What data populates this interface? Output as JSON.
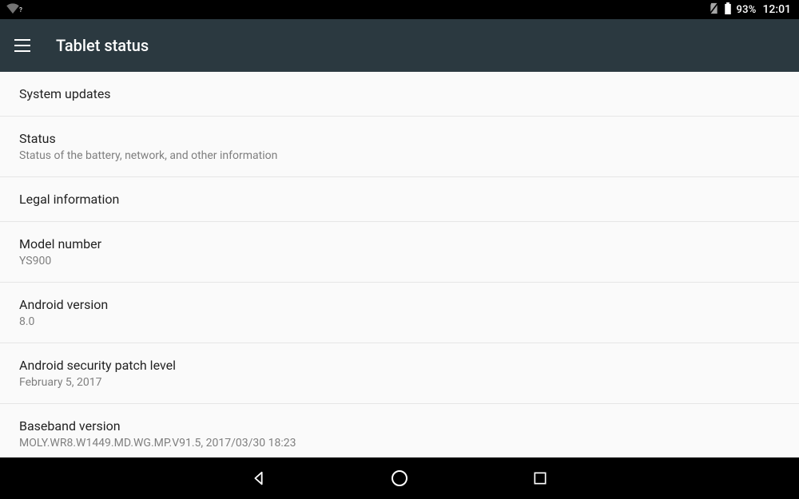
{
  "statusbar": {
    "wifi_question": "?",
    "battery_pct": "93%",
    "clock": "12:01"
  },
  "actionbar": {
    "title": "Tablet status"
  },
  "rows": {
    "system_updates": {
      "title": "System updates"
    },
    "status": {
      "title": "Status",
      "sub": "Status of the battery, network, and other information"
    },
    "legal": {
      "title": "Legal information"
    },
    "model": {
      "title": "Model number",
      "sub": "YS900"
    },
    "android_version": {
      "title": "Android version",
      "sub": "8.0"
    },
    "security_patch": {
      "title": "Android security patch level",
      "sub": "February 5, 2017"
    },
    "baseband": {
      "title": "Baseband version",
      "sub": "MOLY.WR8.W1449.MD.WG.MP.V91.5, 2017/03/30 18:23"
    }
  }
}
